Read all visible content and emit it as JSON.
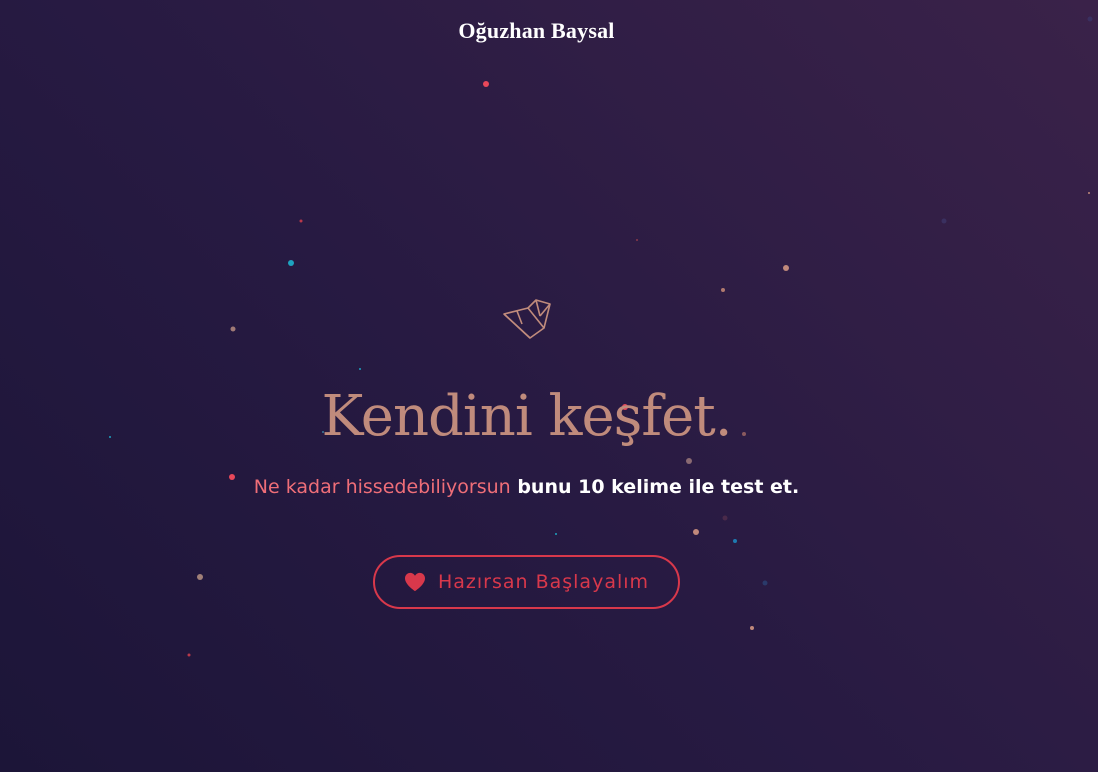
{
  "header": {
    "site_title": "Oğuzhan Baysal"
  },
  "hero": {
    "logo_icon": "origami-bird-icon",
    "headline": "Kendini keşfet.",
    "subline_highlight": "Ne kadar hissedebiliyorsun",
    "subline_rest": " bunu 10 kelime ile test et.",
    "cta_icon": "heart-icon",
    "cta_label": "Hazırsan Başlayalım"
  },
  "colors": {
    "background_start": "#1c1538",
    "background_end": "#3a2249",
    "accent_copper": "#c08b7c",
    "accent_red": "#d8384b",
    "highlight_pink": "#ef6e78"
  }
}
